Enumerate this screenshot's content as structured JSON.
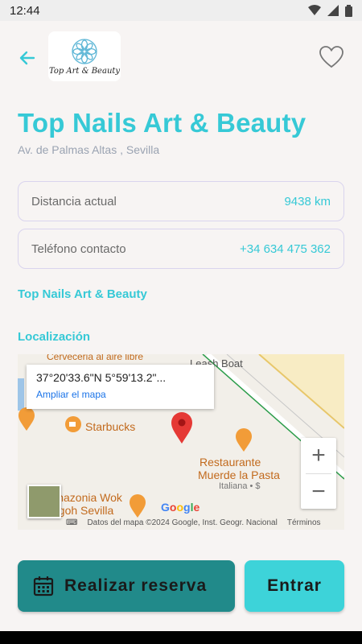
{
  "status_bar": {
    "time": "12:44"
  },
  "header": {
    "logo_text": "Top Art & Beauty"
  },
  "business": {
    "title": "Top Nails Art & Beauty",
    "address": "Av. de Palmas Altas , Sevilla"
  },
  "distance": {
    "label": "Distancia actual",
    "value": "9438 km"
  },
  "phone": {
    "label": "Teléfono contacto",
    "value": "+34 634 475 362"
  },
  "sections": {
    "name": "Top Nails Art & Beauty",
    "location": "Localización"
  },
  "map": {
    "coords": "37°20'33.6\"N 5°59'13.2\"...",
    "expand_link": "Ampliar el mapa",
    "labels": {
      "cerveceria": "Cerveceria al aire libre",
      "boat": "Leash Boat",
      "starbucks": "Starbucks",
      "restaurante_1": "Restaurante",
      "restaurante_2": "Muerde la Pasta",
      "restaurante_3": "Italiana • $",
      "wok_1": "Amazonia Wok",
      "wok_2": "Tagoh Sevilla"
    },
    "google": "Google",
    "attribution": "Datos del mapa ©2024 Google, Inst. Geogr. Nacional",
    "terms": "Términos",
    "zoom_in": "+",
    "zoom_out": "−"
  },
  "actions": {
    "reserve": "Realizar reserva",
    "enter": "Entrar"
  },
  "colors": {
    "accent": "#36c9d6",
    "reserve_button": "#218a8a",
    "enter_button": "#3dd3d9"
  }
}
